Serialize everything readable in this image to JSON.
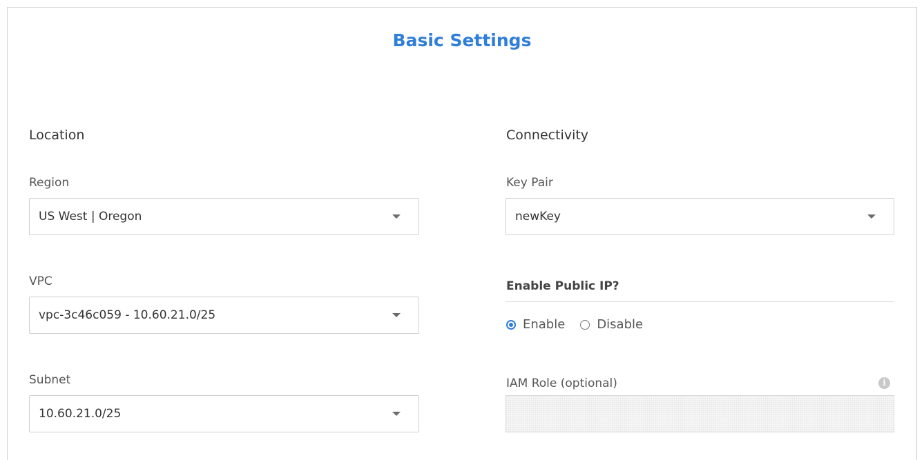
{
  "page": {
    "title": "Basic Settings"
  },
  "location": {
    "heading": "Location",
    "region": {
      "label": "Region",
      "value": "US West | Oregon"
    },
    "vpc": {
      "label": "VPC",
      "value": "vpc-3c46c059 - 10.60.21.0/25"
    },
    "subnet": {
      "label": "Subnet",
      "value": "10.60.21.0/25"
    }
  },
  "connectivity": {
    "heading": "Connectivity",
    "key_pair": {
      "label": "Key Pair",
      "value": "newKey"
    },
    "public_ip": {
      "label": "Enable Public IP?",
      "options": [
        {
          "label": "Enable",
          "selected": true
        },
        {
          "label": "Disable",
          "selected": false
        }
      ]
    },
    "iam_role": {
      "label": "IAM Role (optional)",
      "value": "",
      "info_icon": "info-icon"
    }
  },
  "colors": {
    "accent": "#2f7ed8",
    "border": "#cfcfcf",
    "text": "#333333"
  }
}
